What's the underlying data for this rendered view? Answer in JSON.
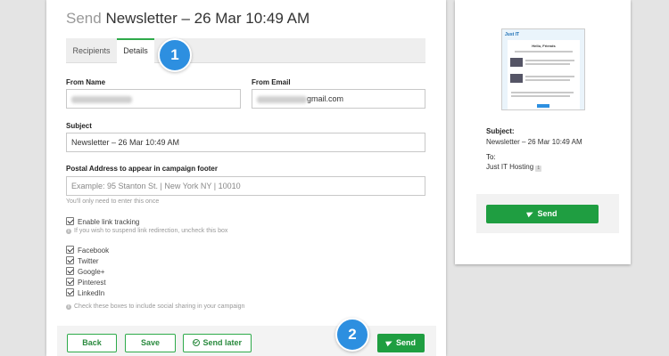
{
  "page": {
    "title_prefix": "Send",
    "title_main": "Newsletter – 26 Mar 10:49 AM"
  },
  "tabs": [
    {
      "label": "Recipients"
    },
    {
      "label": "Details"
    }
  ],
  "form": {
    "from_name_label": "From Name",
    "from_email_label": "From Email",
    "from_email_suffix": "gmail.com",
    "subject_label": "Subject",
    "subject_value": "Newsletter – 26 Mar 10:49 AM",
    "postal_label": "Postal Address to appear in campaign footer",
    "postal_placeholder": "Example: 95 Stanton St. | New York NY | 10010",
    "postal_hint": "You'll only need to enter this once",
    "link_tracking_label": "Enable link tracking",
    "link_tracking_hint": "If you wish to suspend link redirection, uncheck this box",
    "social": [
      "Facebook",
      "Twitter",
      "Google+",
      "Pinterest",
      "LinkedIn"
    ],
    "social_hint": "Check these boxes to include social sharing in your campaign"
  },
  "buttons": {
    "back": "Back",
    "save": "Save",
    "send_later": "Send later",
    "send": "Send"
  },
  "steps": {
    "one": "1",
    "two": "2"
  },
  "preview": {
    "logo_text": "Just IT",
    "greeting": "Hello, Friends",
    "subject_label": "Subject:",
    "subject_value": "Newsletter – 26 Mar 10:49 AM",
    "to_label": "To:",
    "to_value": "Just IT Hosting",
    "to_count": "1",
    "send_label": "Send"
  },
  "colors": {
    "accent_green": "#1f9e41",
    "step_blue": "#2d8fe0"
  }
}
